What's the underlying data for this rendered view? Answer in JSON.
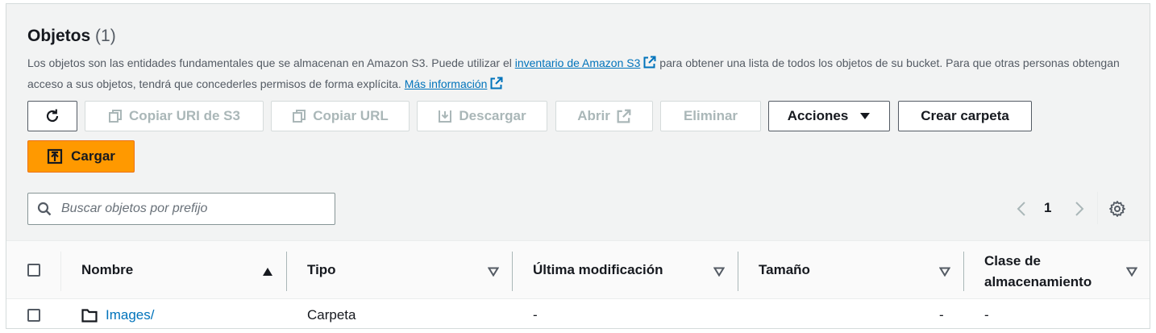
{
  "header": {
    "title": "Objetos",
    "count": "(1)"
  },
  "description": {
    "text_before_link": "Los objetos son las entidades fundamentales que se almacenan en Amazon S3. Puede utilizar el ",
    "inventory_link": "inventario de Amazon S3",
    "text_after_link": " para obtener una lista de todos los objetos de su bucket. Para que otras personas obtengan acceso a sus objetos, tendrá que concederles permisos de forma explícita. ",
    "more_info_link": "Más información"
  },
  "toolbar": {
    "copy_s3_uri": "Copiar URI de S3",
    "copy_url": "Copiar URL",
    "download": "Descargar",
    "open": "Abrir",
    "delete": "Eliminar",
    "actions": "Acciones",
    "create_folder": "Crear carpeta",
    "upload": "Cargar"
  },
  "search": {
    "placeholder": "Buscar objetos por prefijo"
  },
  "pagination": {
    "current_page": "1"
  },
  "table": {
    "columns": [
      "Nombre",
      "Tipo",
      "Última modificación",
      "Tamaño",
      "Clase de",
      "almacenamiento"
    ],
    "rows": [
      {
        "name": "Images/",
        "type": "Carpeta",
        "last_modified": "-",
        "size": "-",
        "storage_class": "-"
      }
    ]
  },
  "colors": {
    "primary": "#ff9900",
    "link": "#0073bb",
    "text": "#16191f",
    "muted": "#545b64",
    "disabled": "#aab7b8"
  }
}
